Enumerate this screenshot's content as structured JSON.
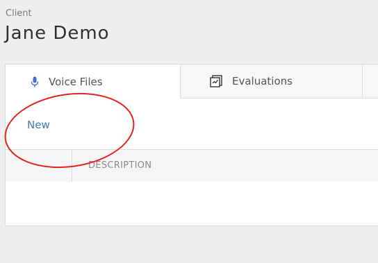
{
  "header": {
    "label": "Client",
    "name": "Jane Demo"
  },
  "tabs": [
    {
      "label": "Voice Files",
      "icon": "microphone-icon",
      "active": true
    },
    {
      "label": "Evaluations",
      "icon": "evaluation-form-icon",
      "active": false
    }
  ],
  "toolbar": {
    "new_label": "New"
  },
  "table": {
    "columns": [
      "DESCRIPTION"
    ]
  },
  "colors": {
    "link": "#3a78c2",
    "annotation": "#e3241b",
    "mic_icon": "#4a6fd1"
  }
}
